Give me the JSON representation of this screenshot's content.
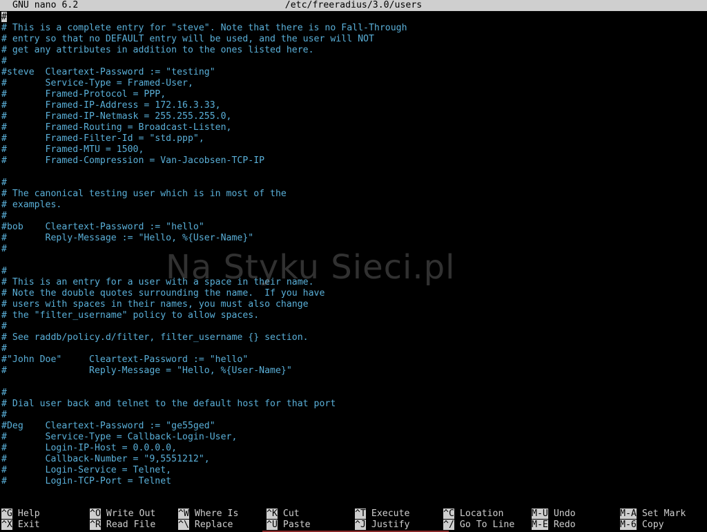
{
  "titlebar": {
    "app": "GNU nano 6.2",
    "path": "/etc/freeradius/3.0/users"
  },
  "lines": [
    "#",
    "# This is a complete entry for \"steve\". Note that there is no Fall-Through",
    "# entry so that no DEFAULT entry will be used, and the user will NOT",
    "# get any attributes in addition to the ones listed here.",
    "#",
    "#steve  Cleartext-Password := \"testing\"",
    "#       Service-Type = Framed-User,",
    "#       Framed-Protocol = PPP,",
    "#       Framed-IP-Address = 172.16.3.33,",
    "#       Framed-IP-Netmask = 255.255.255.0,",
    "#       Framed-Routing = Broadcast-Listen,",
    "#       Framed-Filter-Id = \"std.ppp\",",
    "#       Framed-MTU = 1500,",
    "#       Framed-Compression = Van-Jacobsen-TCP-IP",
    "",
    "#",
    "# The canonical testing user which is in most of the",
    "# examples.",
    "#",
    "#bob    Cleartext-Password := \"hello\"",
    "#       Reply-Message := \"Hello, %{User-Name}\"",
    "#",
    "",
    "#",
    "# This is an entry for a user with a space in their name.",
    "# Note the double quotes surrounding the name.  If you have",
    "# users with spaces in their names, you must also change",
    "# the \"filter_username\" policy to allow spaces.",
    "#",
    "# See raddb/policy.d/filter, filter_username {} section.",
    "#",
    "#\"John Doe\"     Cleartext-Password := \"hello\"",
    "#               Reply-Message = \"Hello, %{User-Name}\"",
    "",
    "#",
    "# Dial user back and telnet to the default host for that port",
    "#",
    "#Deg    Cleartext-Password := \"ge55ged\"",
    "#       Service-Type = Callback-Login-User,",
    "#       Login-IP-Host = 0.0.0.0,",
    "#       Callback-Number = \"9,5551212\",",
    "#       Login-Service = Telnet,",
    "#       Login-TCP-Port = Telnet"
  ],
  "watermark": "Na Styku Sieci.pl",
  "shortcuts": [
    {
      "key": "^G",
      "label": "Help"
    },
    {
      "key": "^X",
      "label": "Exit"
    },
    {
      "key": "^O",
      "label": "Write Out"
    },
    {
      "key": "^R",
      "label": "Read File"
    },
    {
      "key": "^W",
      "label": "Where Is"
    },
    {
      "key": "^\\",
      "label": "Replace"
    },
    {
      "key": "^K",
      "label": "Cut"
    },
    {
      "key": "^U",
      "label": "Paste"
    },
    {
      "key": "^T",
      "label": "Execute"
    },
    {
      "key": "^J",
      "label": "Justify"
    },
    {
      "key": "^C",
      "label": "Location"
    },
    {
      "key": "^/",
      "label": "Go To Line"
    },
    {
      "key": "M-U",
      "label": "Undo"
    },
    {
      "key": "M-E",
      "label": "Redo"
    },
    {
      "key": "M-A",
      "label": "Set Mark"
    },
    {
      "key": "M-6",
      "label": "Copy"
    }
  ],
  "colors": {
    "text": "#5ab0d9",
    "background": "#000000",
    "bar": "#cfcfcf"
  }
}
